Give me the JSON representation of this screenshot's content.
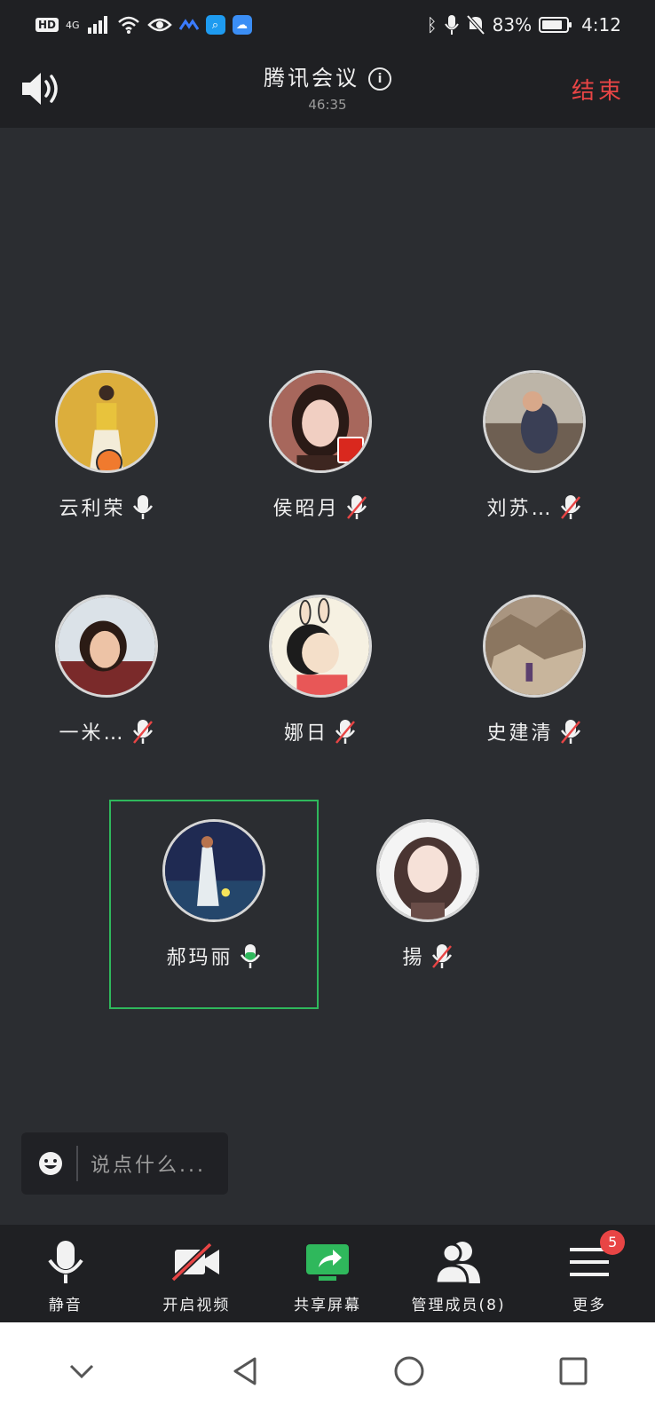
{
  "status_bar": {
    "network_label": "HD",
    "signal_label": "4G",
    "battery": "83%",
    "time": "4:12",
    "battery_level": 0.83
  },
  "header": {
    "title": "腾讯会议",
    "timer": "46:35",
    "end_label": "结束"
  },
  "participants": [
    {
      "name": "云利荣",
      "mic": "on",
      "host": true
    },
    {
      "name": "侯昭月",
      "mic": "muted",
      "flag": true
    },
    {
      "name": "刘苏…",
      "mic": "muted"
    },
    {
      "name": "一米…",
      "mic": "muted"
    },
    {
      "name": "娜日",
      "mic": "muted"
    },
    {
      "name": "史建清",
      "mic": "muted"
    },
    {
      "name": "郝玛丽",
      "mic": "speaking",
      "active": true
    },
    {
      "name": "揚",
      "mic": "muted"
    }
  ],
  "chat": {
    "placeholder": "说点什么..."
  },
  "toolbar": {
    "mute_label": "静音",
    "video_label": "开启视频",
    "share_label": "共享屏幕",
    "members_label": "管理成员(8)",
    "more_label": "更多",
    "more_badge": "5"
  },
  "colors": {
    "accent_green": "#2fb85c",
    "end_red": "#e84545",
    "background": "#2b2d31"
  }
}
